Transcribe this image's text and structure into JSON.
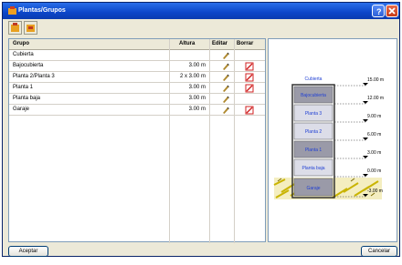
{
  "window": {
    "title": "Plantas/Grupos"
  },
  "grid": {
    "headers": {
      "group": "Grupo",
      "height": "Altura",
      "edit": "Editar",
      "delete": "Borrar"
    },
    "rows": [
      {
        "name": "Cubierta",
        "height": "",
        "delete": false
      },
      {
        "name": "Bajocubierta",
        "height": "3.00 m",
        "delete": true
      },
      {
        "name": "Planta 2/Planta 3",
        "height": "2 x 3.00 m",
        "delete": true
      },
      {
        "name": "Planta 1",
        "height": "3.00 m",
        "delete": true
      },
      {
        "name": "Planta baja",
        "height": "3.00 m",
        "delete": false
      },
      {
        "name": "Garaje",
        "height": "3.00 m",
        "delete": true
      }
    ]
  },
  "diagram": {
    "roof_label": "Cubierta",
    "floors": [
      "Bajocubierta",
      "Planta 3",
      "Planta 2",
      "Planta 1",
      "Planta baja",
      "Garaje"
    ],
    "levels": [
      "15.00 m",
      "12.00 m",
      "9.00 m",
      "6.00 m",
      "3.00 m",
      "0.00 m",
      "-3.00 m"
    ]
  },
  "buttons": {
    "accept": "Aceptar",
    "cancel": "Cancelar"
  },
  "colors": {
    "titlebar": "#0b46c9",
    "floor_light": "#dcdde8",
    "floor_dark": "#9a9aa8",
    "label_blue": "#1f3fd4",
    "ground": "#e6d84a"
  }
}
